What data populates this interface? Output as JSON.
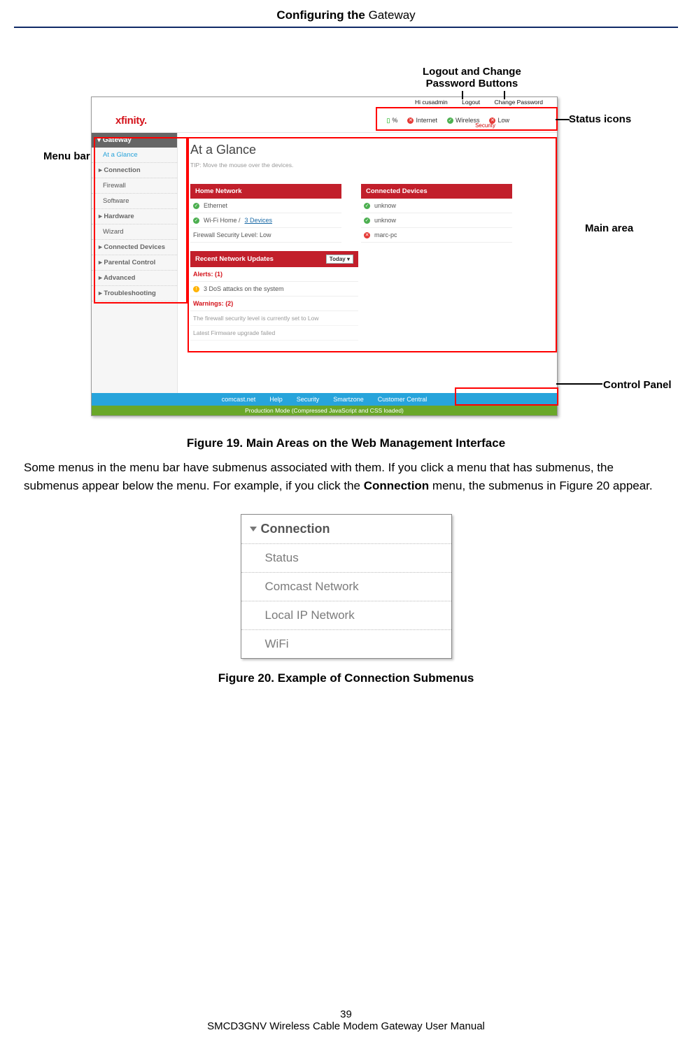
{
  "header": {
    "title_prefix": "Configuring the",
    "title_bold": " Gateway"
  },
  "annotations": {
    "logout": "Logout and Change\nPassword Buttons",
    "status_icons": "Status icons",
    "menu_bar": "Menu bar",
    "main_area": "Main area",
    "control_panel": "Control Panel"
  },
  "screenshot": {
    "greeting": "Hi cusadmin",
    "logout": "Logout",
    "change_password": "Change Password",
    "brand": "xfinity.",
    "status": {
      "pct": "%",
      "internet": "Internet",
      "wireless": "Wireless",
      "low": "Low",
      "security": "Security"
    },
    "sidebar": {
      "header": "Gateway",
      "items": [
        {
          "label": "At a Glance",
          "selected": true
        },
        {
          "label": "Connection",
          "top": true
        },
        {
          "label": "Firewall"
        },
        {
          "label": "Software"
        },
        {
          "label": "Hardware",
          "top": true
        },
        {
          "label": "Wizard"
        },
        {
          "label": "Connected Devices",
          "top": true
        },
        {
          "label": "Parental Control",
          "top": true
        },
        {
          "label": "Advanced",
          "top": true
        },
        {
          "label": "Troubleshooting",
          "top": true
        }
      ]
    },
    "main": {
      "title": "At a Glance",
      "tip": "TIP: Move the mouse over the devices.",
      "home_network": {
        "header": "Home Network",
        "ethernet": "Ethernet",
        "wifi_label": "Wi-Fi Home /",
        "wifi_link": "3 Devices",
        "firewall": "Firewall Security Level: Low"
      },
      "connected_devices": {
        "header": "Connected Devices",
        "r1": "unknow",
        "r2": "unknow",
        "r3": "marc-pc"
      },
      "recent": {
        "header": "Recent Network Updates",
        "selector": "Today",
        "alerts_label": "Alerts:",
        "alerts_count": "(1)",
        "alert1": "3 DoS attacks on the system",
        "warnings_label": "Warnings:",
        "warnings_count": "(2)",
        "warn1": "The firewall security level is currently set to Low",
        "warn2": "Latest Firmware upgrade failed"
      }
    },
    "bluebar": {
      "l1": "comcast.net",
      "l2": "Help",
      "l3": "Security",
      "l4": "Smartzone",
      "l5": "Customer Central"
    },
    "greenbar": "Production Mode (Compressed JavaScript and CSS loaded)"
  },
  "captions": {
    "fig19": "Figure 19. Main Areas on the Web Management Interface",
    "fig20": "Figure 20. Example of Connection Submenus"
  },
  "body_paragraph": {
    "p1a": "Some menus in the menu bar have submenus associated with them. If you click a menu that has submenus, the submenus appear below the menu. For example, if you click the ",
    "p1b": "Connection",
    "p1c": " menu, the submenus in Figure 20 appear."
  },
  "submenu": {
    "header": "Connection",
    "items": [
      "Status",
      "Comcast Network",
      "Local IP Network",
      "WiFi"
    ]
  },
  "footer": {
    "page_number": "39",
    "manual": "SMCD3GNV Wireless Cable Modem Gateway User Manual"
  }
}
